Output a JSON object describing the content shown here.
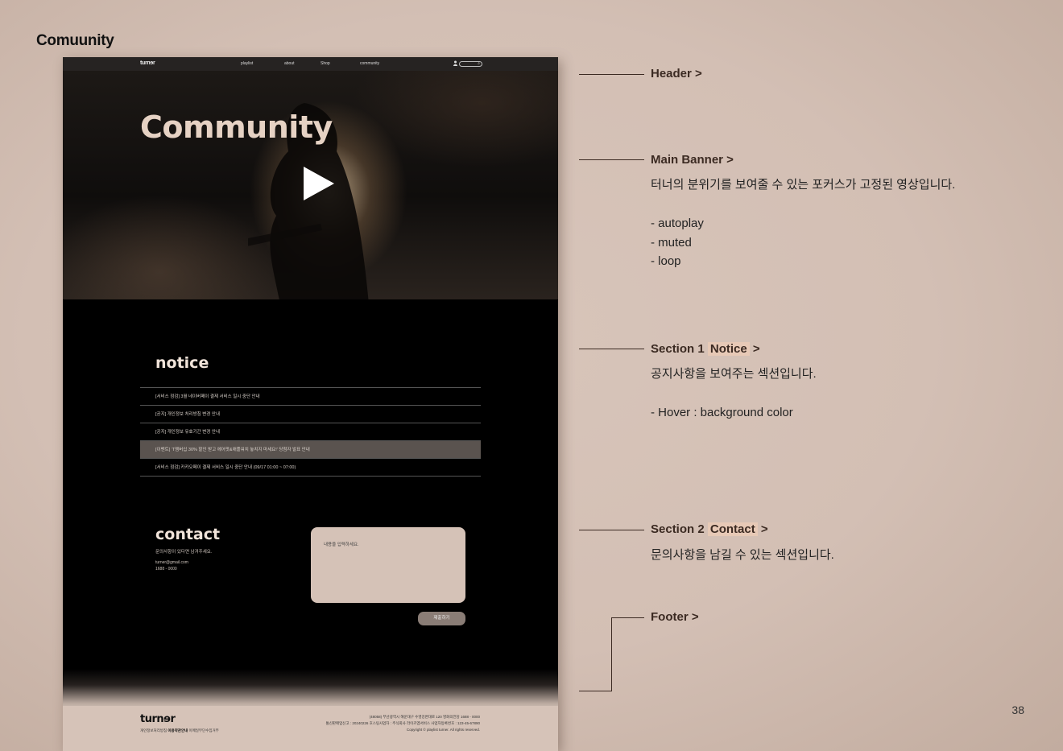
{
  "doc_title": "Comuunity",
  "page_number": "38",
  "mockup": {
    "header": {
      "logo": "turnɘr",
      "nav": [
        "playlist",
        "about",
        "Shop",
        "community"
      ]
    },
    "banner": {
      "title": "Community"
    },
    "notice": {
      "title": "notice",
      "items": [
        "[서비스 점검] 3월 네이버페이 결제 서비스 일시 중단 안내",
        "[공지] 개인정보 처리방침 변경 안내",
        "[공지] 개인정보 유효기간 변경 안내",
        "[이벤트] 'T멤버십 30% 할인 받고 에어팟&애플워치 놓치지 마세요!' 당첨자 발표 안내",
        "[서비스 점검] 카카오페이 결제 서비스 일시 중단 안내 (09/17 01:00 ~ 07:00)"
      ]
    },
    "contact": {
      "title": "contact",
      "desc": "문의사항이 있다면 남겨주세요.",
      "email": "turner@gmail.com",
      "phone": "1688 - 0000",
      "placeholder": "내용을 입력하세요.",
      "submit": "제출하기"
    },
    "footer": {
      "logo": "turnɘr",
      "link1": "개인정보처리방침",
      "link2": "이용약관안내",
      "link3": "이메일무단수집거부",
      "info1": "(48058) 부산광역시 해운대구 수영강변대로 120 영화의전당 1688 - 0000",
      "info2": "통신판매업신고 : 20240226 호스팅사업자 : 주식회사 라이츠엠서비스 사업자등록번호 : 123-45-67890",
      "info3": "Copyright © playlist turner. All rights reserved."
    }
  },
  "annotations": {
    "header": "Header >",
    "banner": {
      "title": "Main Banner >",
      "desc": "터너의 분위기를 보여줄 수 있는 포커스가 고정된 영상입니다.",
      "bullets": [
        "- autoplay",
        "- muted",
        "- loop"
      ]
    },
    "section1": {
      "prefix": "Section 1",
      "highlight": "Notice",
      "suffix": ">",
      "desc": "공지사항을 보여주는 섹션입니다.",
      "hover": "- Hover : background color"
    },
    "section2": {
      "prefix": "Section 2",
      "highlight": "Contact",
      "suffix": ">",
      "desc": "문의사항을 남길 수 있는 섹션입니다."
    },
    "footer": "Footer >"
  }
}
